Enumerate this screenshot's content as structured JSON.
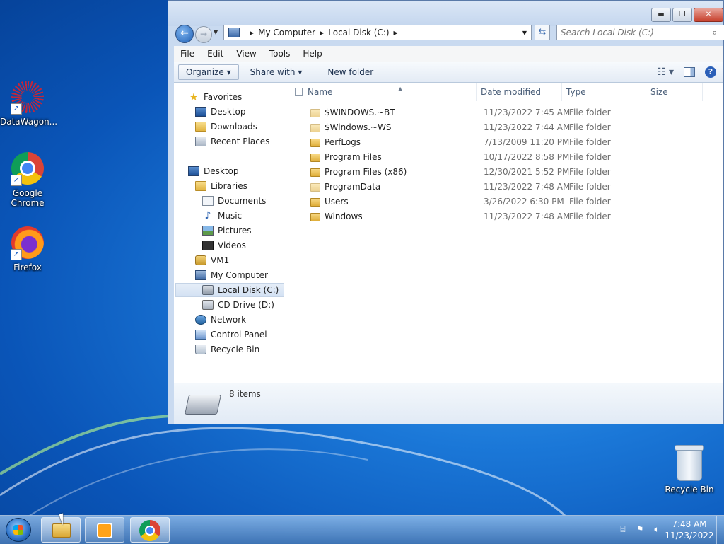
{
  "desktop": {
    "icons": [
      {
        "label": "DataWagon...",
        "icon": "datawagon-icon"
      },
      {
        "label": "Google Chrome",
        "icon": "chrome-icon"
      },
      {
        "label": "Firefox",
        "icon": "firefox-icon"
      },
      {
        "label": "Recycle Bin",
        "icon": "recycle-bin-icon"
      }
    ]
  },
  "window": {
    "buttons": {
      "minimize": "▬",
      "maximize": "❐",
      "close": "✕"
    },
    "address": {
      "crumbs": [
        "My Computer",
        "Local Disk (C:)"
      ]
    },
    "search": {
      "placeholder": "Search Local Disk (C:)"
    },
    "menu": [
      "File",
      "Edit",
      "View",
      "Tools",
      "Help"
    ],
    "toolbar": {
      "organize": "Organize ▾",
      "share_with": "Share with ▾",
      "new_folder": "New folder"
    },
    "nav_pane": {
      "favorites": "Favorites",
      "desktop_fav": "Desktop",
      "downloads": "Downloads",
      "recent_places": "Recent Places",
      "desktop": "Desktop",
      "libraries": "Libraries",
      "documents": "Documents",
      "music": "Music",
      "pictures": "Pictures",
      "videos": "Videos",
      "vm1": "VM1",
      "my_computer": "My Computer",
      "local_disk": "Local Disk (C:)",
      "cd_drive": "CD Drive (D:)",
      "network": "Network",
      "control_panel": "Control Panel",
      "recycle_bin": "Recycle Bin"
    },
    "columns": {
      "name": "Name",
      "date": "Date modified",
      "type": "Type",
      "size": "Size"
    },
    "files": [
      {
        "name": "$WINDOWS.~BT",
        "date": "11/23/2022 7:45 AM",
        "type": "File folder"
      },
      {
        "name": "$Windows.~WS",
        "date": "11/23/2022 7:44 AM",
        "type": "File folder"
      },
      {
        "name": "PerfLogs",
        "date": "7/13/2009 11:20 PM",
        "type": "File folder"
      },
      {
        "name": "Program Files",
        "date": "10/17/2022 8:58 PM",
        "type": "File folder"
      },
      {
        "name": "Program Files (x86)",
        "date": "12/30/2021 5:52 PM",
        "type": "File folder"
      },
      {
        "name": "ProgramData",
        "date": "11/23/2022 7:48 AM",
        "type": "File folder"
      },
      {
        "name": "Users",
        "date": "3/26/2022 6:30 PM",
        "type": "File folder"
      },
      {
        "name": "Windows",
        "date": "11/23/2022 7:48 AM",
        "type": "File folder"
      }
    ],
    "details": {
      "count": "8 items"
    }
  },
  "taskbar": {
    "clock_time": "7:48 AM",
    "clock_date": "11/23/2022"
  }
}
